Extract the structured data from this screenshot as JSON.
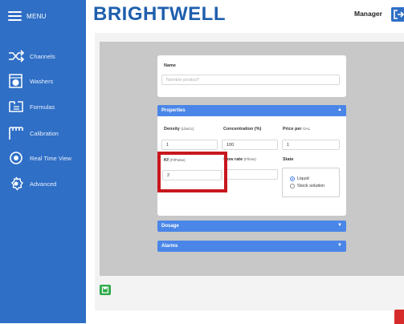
{
  "sidebar": {
    "menu_label": "MENU",
    "items": [
      {
        "label": "Channels",
        "icon": "shuffle-icon"
      },
      {
        "label": "Washers",
        "icon": "washer-icon"
      },
      {
        "label": "Formulas",
        "icon": "formula-icon"
      },
      {
        "label": "Calibration",
        "icon": "calibration-icon"
      },
      {
        "label": "Real Time View",
        "icon": "eye-icon"
      },
      {
        "label": "Advanced",
        "icon": "gear-icon"
      }
    ]
  },
  "header": {
    "brand": "BRIGHTWELL",
    "user": "Manager",
    "logout_icon": "logout-icon"
  },
  "form": {
    "name": {
      "label": "Name",
      "placeholder": "Nombre product*"
    },
    "properties": {
      "title": "Properties",
      "arrow": "▲",
      "density": {
        "label": "Density",
        "unit": "(Lbs/cc)",
        "value": "1"
      },
      "concentration": {
        "label": "Concentration (%)",
        "value": "100"
      },
      "price": {
        "label": "Price per",
        "unit": "GAL",
        "value": "1"
      },
      "kf": {
        "label": "Kf",
        "unit": "(Fl/Pulse)",
        "value": "2"
      },
      "flow_rate": {
        "label": "Flow rate",
        "unit": "(Fl/min)",
        "value": ""
      },
      "state": {
        "label": "State",
        "options": [
          "Liquid",
          "Stock solution"
        ],
        "selected": "Liquid"
      }
    },
    "dosage": {
      "title": "Dosage",
      "arrow": "▼"
    },
    "alarms": {
      "title": "Alarms",
      "arrow": "▼"
    }
  },
  "colors": {
    "sidebar": "#2f6fc6",
    "section_header": "#4a86e8",
    "highlight": "#c8171e",
    "save": "#2eaa4a"
  }
}
